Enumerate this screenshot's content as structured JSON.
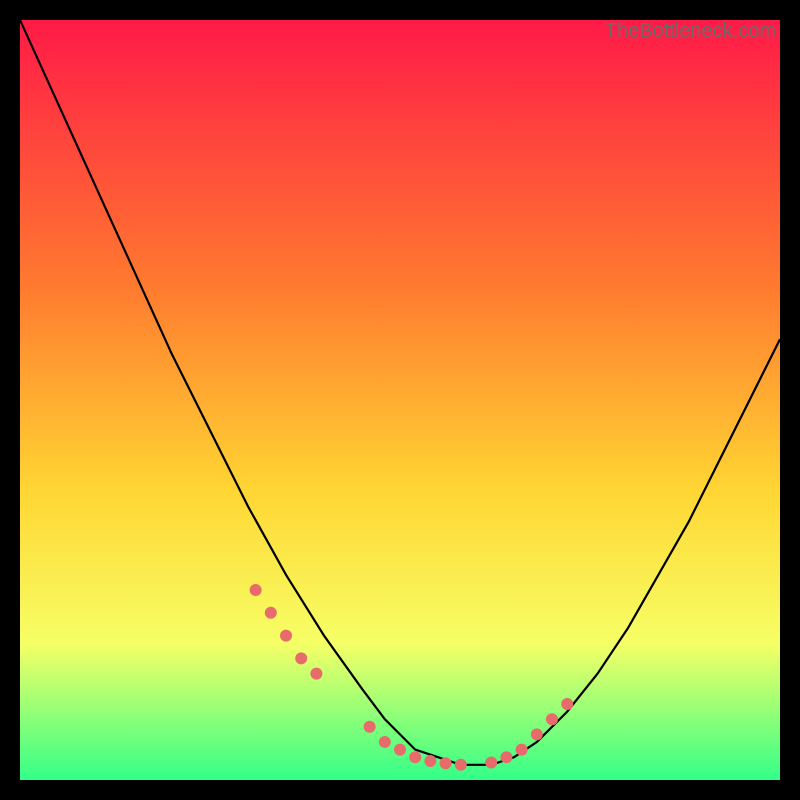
{
  "watermark": "TheBottleneck.com",
  "colors": {
    "bg_black": "#000000",
    "gradient_top": "#ff1a47",
    "gradient_mid1": "#ff7a2f",
    "gradient_mid2": "#ffd633",
    "gradient_mid3": "#f6ff66",
    "gradient_bottom": "#33ff88",
    "curve": "#000000",
    "dot": "#e86b6b"
  },
  "chart_data": {
    "type": "line",
    "title": "",
    "xlabel": "",
    "ylabel": "",
    "xlim": [
      0,
      100
    ],
    "ylim": [
      0,
      100
    ],
    "series": [
      {
        "name": "bottleneck-curve",
        "x": [
          0,
          5,
          10,
          15,
          20,
          25,
          30,
          35,
          40,
          45,
          48,
          50,
          52,
          55,
          58,
          60,
          62,
          65,
          68,
          72,
          76,
          80,
          84,
          88,
          92,
          96,
          100
        ],
        "y": [
          100,
          89,
          78,
          67,
          56,
          46,
          36,
          27,
          19,
          12,
          8,
          6,
          4,
          3,
          2,
          2,
          2,
          3,
          5,
          9,
          14,
          20,
          27,
          34,
          42,
          50,
          58
        ]
      }
    ],
    "dots": {
      "name": "highlight-dots",
      "x": [
        31,
        33,
        35,
        37,
        39,
        46,
        48,
        50,
        52,
        54,
        56,
        58,
        62,
        64,
        66,
        68,
        70,
        72
      ],
      "y": [
        25,
        22,
        19,
        16,
        14,
        7,
        5,
        4,
        3,
        2.5,
        2.2,
        2,
        2.3,
        3,
        4,
        6,
        8,
        10
      ]
    }
  }
}
